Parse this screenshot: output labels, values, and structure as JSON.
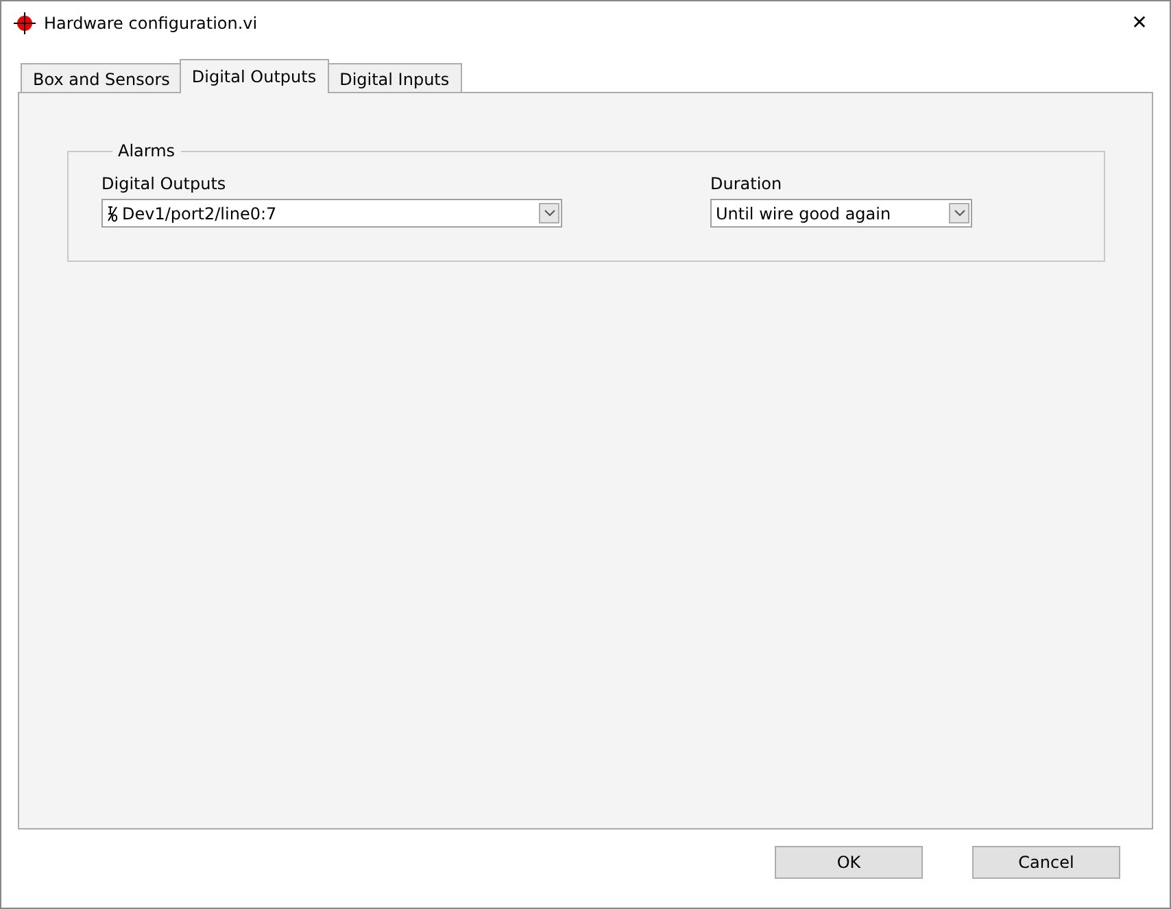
{
  "window": {
    "title": "Hardware configuration.vi",
    "close": "✕"
  },
  "tabs": [
    {
      "label": "Box and Sensors",
      "selected": false
    },
    {
      "label": "Digital Outputs",
      "selected": true
    },
    {
      "label": "Digital Inputs",
      "selected": false
    }
  ],
  "group": {
    "title": "Alarms",
    "fields": [
      {
        "label": "Digital Outputs",
        "value": "Dev1/port2/line0:7",
        "kind": "io"
      },
      {
        "label": "Duration",
        "value": "Until wire good again",
        "kind": "plain"
      }
    ]
  },
  "buttons": [
    "OK",
    "Cancel"
  ]
}
